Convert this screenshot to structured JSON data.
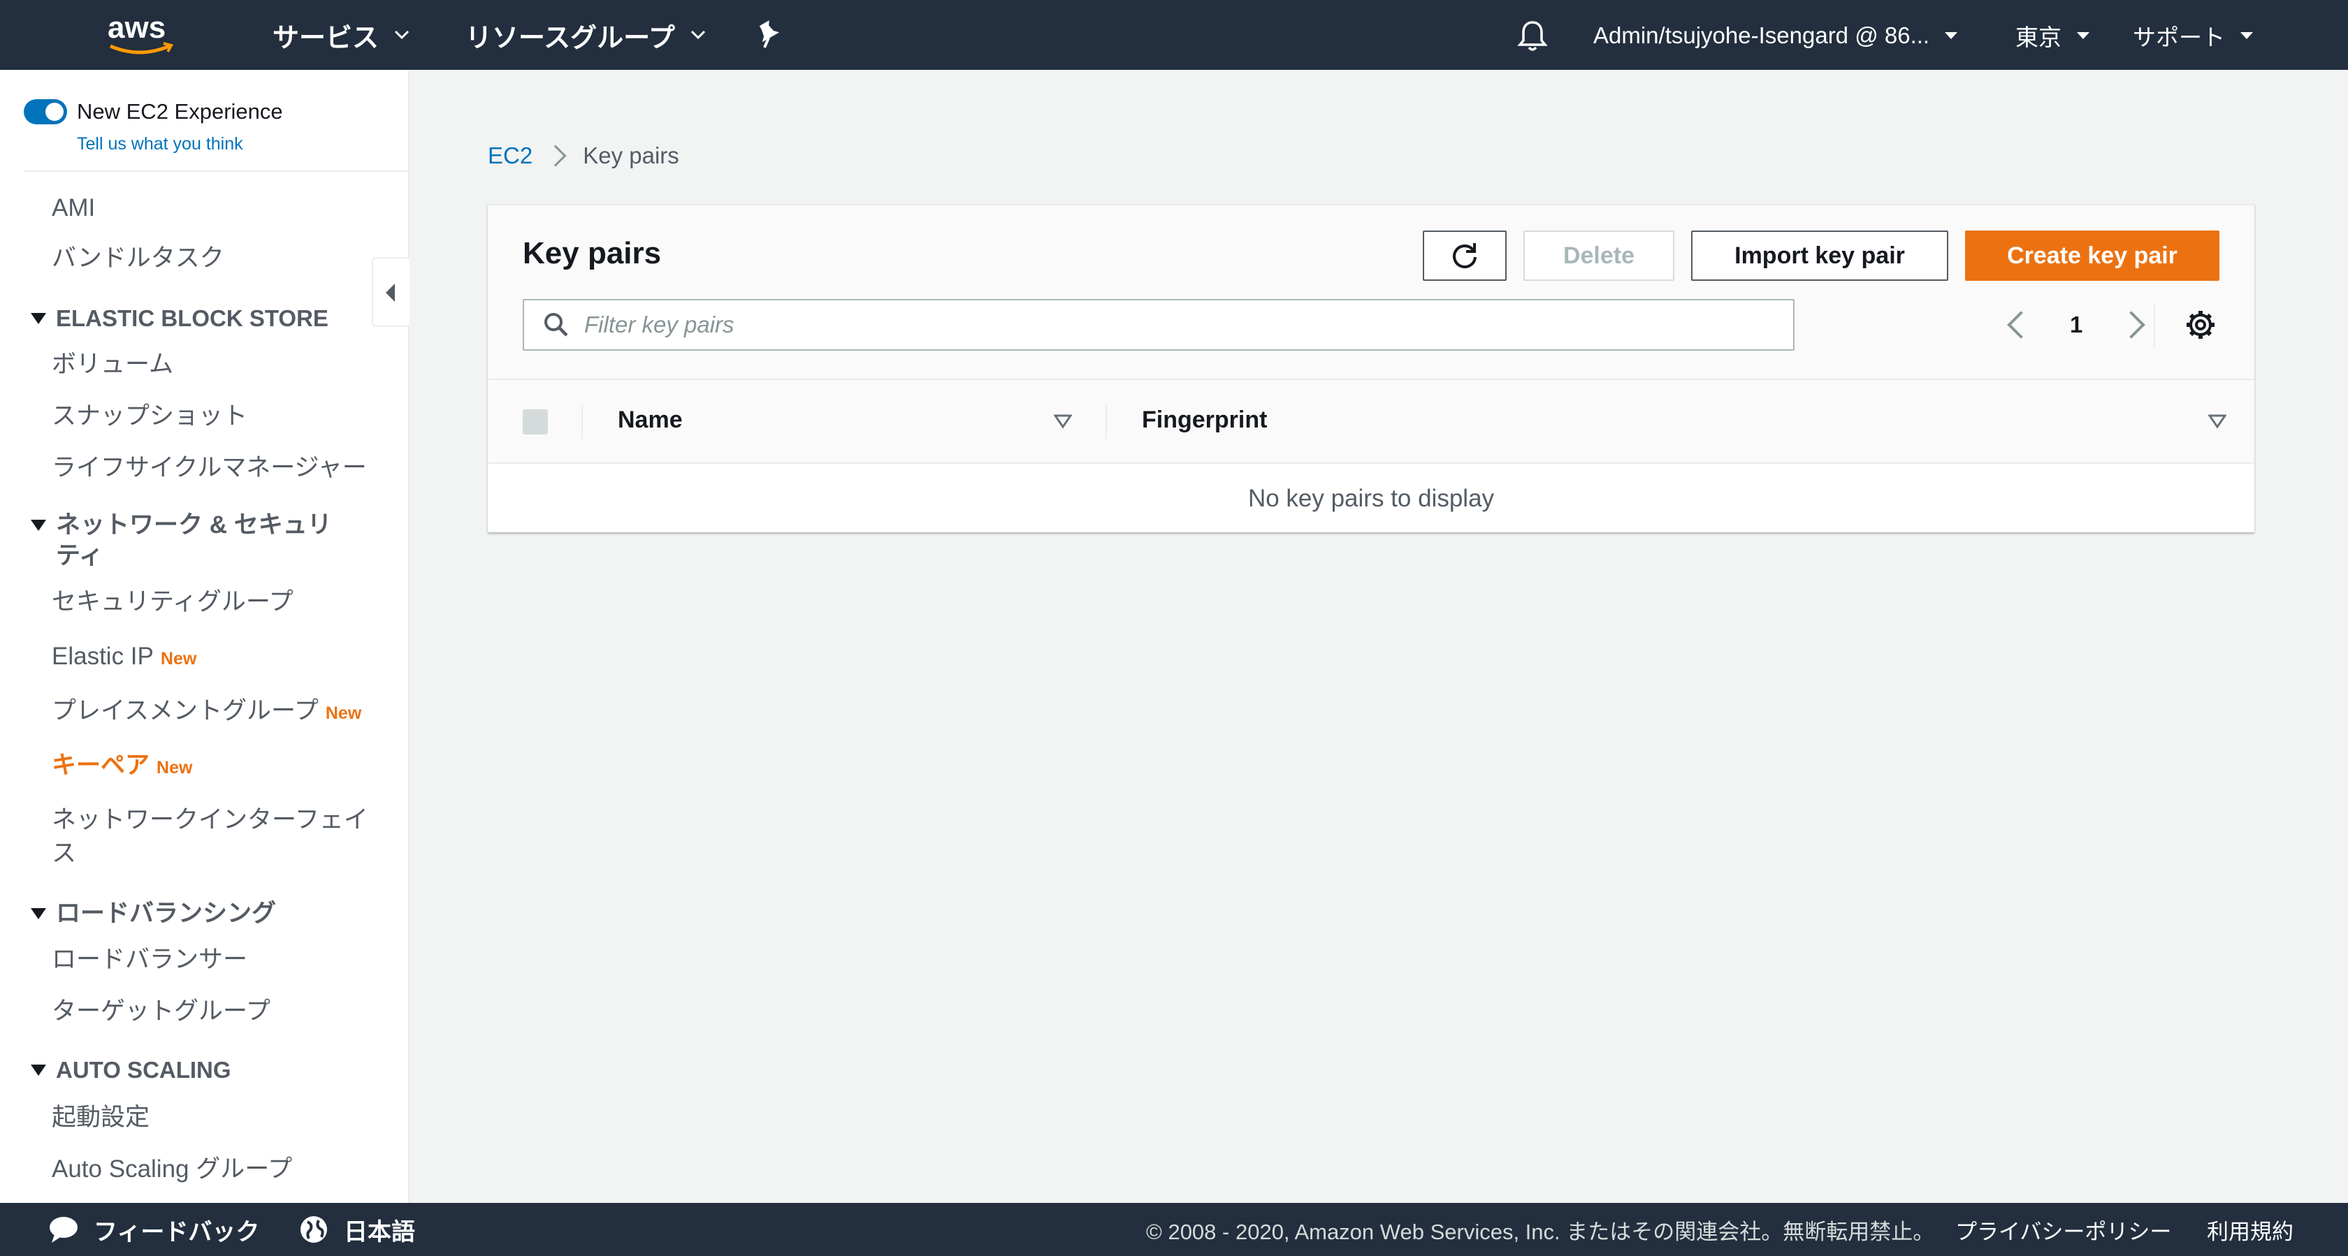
{
  "topnav": {
    "logo_text": "aws",
    "services_label": "サービス",
    "resource_groups_label": "リソースグループ",
    "account_label": "Admin/tsujyohe-Isengard @ 86...",
    "region_label": "東京",
    "support_label": "サポート"
  },
  "sidebar": {
    "toggle_label": "New EC2 Experience",
    "feedback_link": "Tell us what you think",
    "items": {
      "ami": "AMI",
      "bundle_tasks": "バンドルタスク",
      "ebs_section": "ELASTIC BLOCK STORE",
      "volumes": "ボリューム",
      "snapshots": "スナップショット",
      "lifecycle_manager": "ライフサイクルマネージャー",
      "network_section_line1": "ネットワーク & セキュリ",
      "network_section_line2": "ティ",
      "security_groups": "セキュリティグループ",
      "elastic_ip": "Elastic IP",
      "placement_groups": "プレイスメントグループ",
      "key_pairs": "キーペア",
      "network_interfaces_line1": "ネットワークインターフェイ",
      "network_interfaces_line2": "ス",
      "lb_section": "ロードバランシング",
      "load_balancers": "ロードバランサー",
      "target_groups": "ターゲットグループ",
      "as_section": "AUTO SCALING",
      "launch_configs": "起動設定",
      "as_groups": "Auto Scaling グループ"
    },
    "new_badge": "New"
  },
  "breadcrumb": {
    "root": "EC2",
    "current": "Key pairs"
  },
  "panel": {
    "title": "Key pairs",
    "delete_label": "Delete",
    "import_label": "Import key pair",
    "create_label": "Create key pair",
    "search_placeholder": "Filter key pairs",
    "page_number": "1",
    "columns": [
      "Name",
      "Fingerprint"
    ],
    "empty_text": "No key pairs to display"
  },
  "footer": {
    "feedback": "フィードバック",
    "language": "日本語",
    "copyright": "© 2008 - 2020, Amazon Web Services, Inc. またはその関連会社。無断転用禁止。",
    "privacy": "プライバシーポリシー",
    "terms": "利用規約"
  },
  "colors": {
    "nav_bg": "#232f3e",
    "accent_orange": "#ec7211",
    "link_blue": "#0073bb"
  }
}
